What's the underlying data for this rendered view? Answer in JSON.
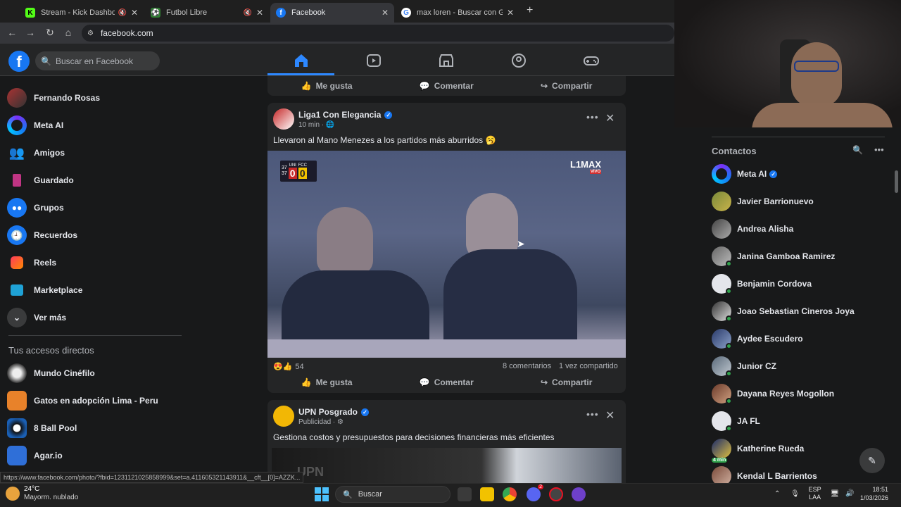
{
  "browser": {
    "tabs": [
      {
        "title": "Stream - Kick Dashboard",
        "muted": true,
        "active": false
      },
      {
        "title": "Futbol Libre",
        "muted": true,
        "active": false
      },
      {
        "title": "Facebook",
        "muted": false,
        "active": true
      },
      {
        "title": "max loren - Buscar con Google",
        "muted": false,
        "active": false
      }
    ],
    "new_tab": "+",
    "url": "facebook.com",
    "status_url": "https://www.facebook.com/photo/?fbid=1231121025858999&set=a.411605321143911&__cft__[0]=AZZK..."
  },
  "fb": {
    "logo": "f",
    "search_placeholder": "Buscar en Facebook",
    "nav_icons": [
      "home-icon",
      "video-icon",
      "marketplace-icon",
      "groups-icon",
      "gaming-icon"
    ]
  },
  "left_nav": {
    "items": [
      {
        "label": "Fernando Rosas",
        "icon": "profile-avatar"
      },
      {
        "label": "Meta AI",
        "icon": "meta-ai-icon"
      },
      {
        "label": "Amigos",
        "icon": "friends-icon"
      },
      {
        "label": "Guardado",
        "icon": "saved-icon"
      },
      {
        "label": "Grupos",
        "icon": "groups-icon"
      },
      {
        "label": "Recuerdos",
        "icon": "memories-icon"
      },
      {
        "label": "Reels",
        "icon": "reels-icon"
      },
      {
        "label": "Marketplace",
        "icon": "marketplace-icon"
      },
      {
        "label": "Ver más",
        "icon": "chevron-down-icon"
      }
    ],
    "shortcuts_title": "Tus accesos directos",
    "shortcuts": [
      {
        "label": "Mundo Cinéfilo"
      },
      {
        "label": "Gatos en adopción Lima - Peru"
      },
      {
        "label": "8 Ball Pool"
      },
      {
        "label": "Agar.io"
      }
    ]
  },
  "actions": {
    "like": "Me gusta",
    "comment": "Comentar",
    "share": "Compartir"
  },
  "posts": [
    {
      "author": "Liga1 Con Elegancia",
      "time": "10 min ·",
      "text": "Llevaron al Mano Menezes a los partidos más aburridos 🥱",
      "overlay_logo": "L1MAX",
      "overlay_sub": "VIVO",
      "score_left": "UNI",
      "score_right": "FCC",
      "score_a": "0",
      "score_b": "0",
      "score_time_1": "37",
      "score_time_2": "37",
      "reactions": "54",
      "comments": "8 comentarios",
      "shares": "1 vez compartido"
    },
    {
      "author": "UPN Posgrado",
      "meta": "Publicidad ·",
      "text": "Gestiona costos y presupuestos para decisiones financieras más eficientes",
      "image_text": "UPN"
    }
  ],
  "contacts": {
    "title": "Contactos",
    "items": [
      {
        "name": "Meta AI",
        "online": false,
        "verified": true
      },
      {
        "name": "Javier Barrionuevo",
        "online": false
      },
      {
        "name": "Andrea Alisha",
        "online": false
      },
      {
        "name": "Janina Gamboa Ramirez",
        "online": true
      },
      {
        "name": "Benjamin Cordova",
        "online": true
      },
      {
        "name": "Joao Sebastian Cineros Joya",
        "online": true
      },
      {
        "name": "Aydee Escudero",
        "online": true
      },
      {
        "name": "Junior CZ",
        "online": true
      },
      {
        "name": "Dayana Reyes Mogollon",
        "online": true
      },
      {
        "name": "JA FL",
        "online": true
      },
      {
        "name": "Katherine Rueda",
        "online": false,
        "badge": "4 min"
      },
      {
        "name": "Kendal L Barrientos",
        "online": false
      }
    ]
  },
  "taskbar": {
    "temp": "24°C",
    "weather": "Mayorm. nublado",
    "search": "Buscar",
    "lang1": "ESP",
    "lang2": "LAA",
    "time": "18:51",
    "date": "1/03/2026",
    "notif_count": "2"
  },
  "colors": {
    "fb_blue": "#1877f2",
    "bg": "#18191a",
    "card": "#242526",
    "online": "#31a24c"
  }
}
